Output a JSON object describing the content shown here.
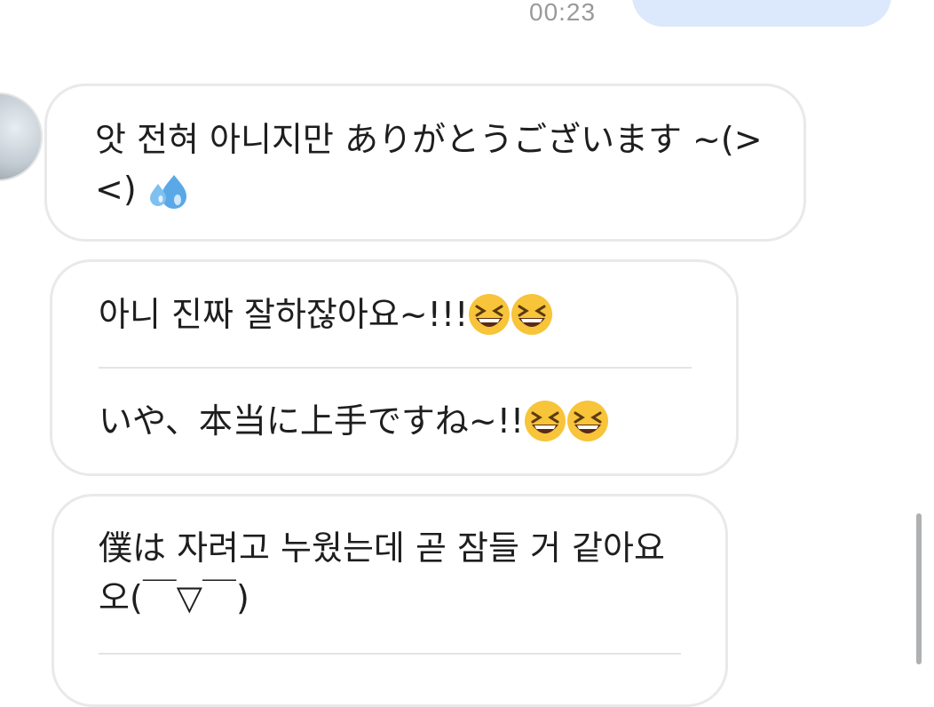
{
  "chat": {
    "timestamp": "00:23",
    "messages": [
      {
        "text": "앗 전혀 아니지만 ありがとうございます ~(><)",
        "emoji": "sweat-droplets-icon"
      },
      {
        "lines": [
          {
            "text": "아니 진짜 잘하잖아요~!!!",
            "emoji": "grinning-squinting-face-icon"
          },
          {
            "text": "いや、本当に上手ですね~!!",
            "emoji": "grinning-squinting-face-icon"
          }
        ]
      },
      {
        "text": "僕は 자려고 누웠는데 곧 잠들 거 같아요오(￣▽￣)"
      }
    ]
  },
  "colors": {
    "sent_bubble": "#dce8fb",
    "received_border": "#e9e9e9",
    "timestamp": "#9a9a9a",
    "text": "#1e1e1e"
  }
}
